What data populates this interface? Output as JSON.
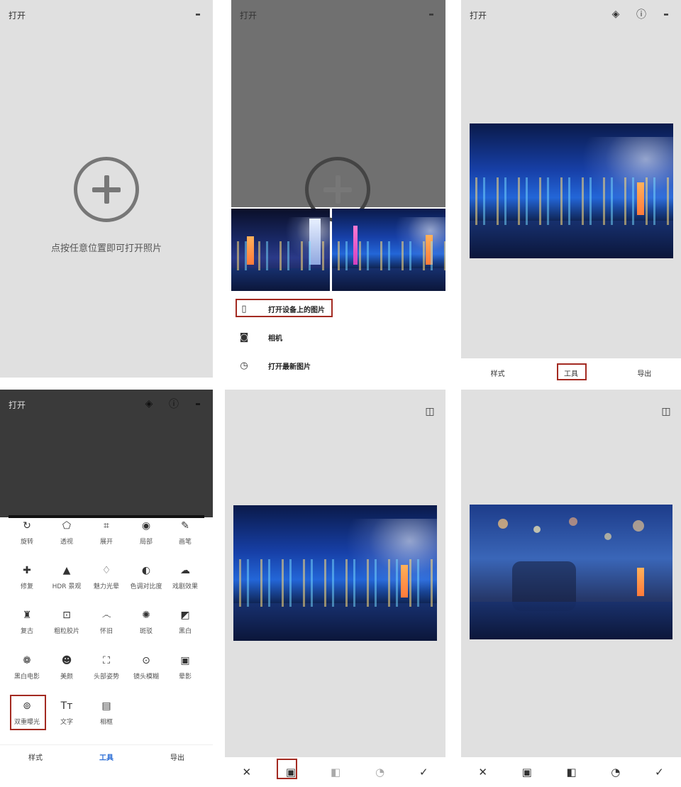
{
  "panel1": {
    "title": "打开",
    "hint": "点按任意位置即可打开照片"
  },
  "panel2": {
    "title": "打开",
    "sheet": [
      {
        "label": "打开设备上的图片",
        "icon": "phone-icon"
      },
      {
        "label": "相机",
        "icon": "camera-icon"
      },
      {
        "label": "打开最新图片",
        "icon": "clock-icon"
      }
    ]
  },
  "panel3": {
    "title": "打开",
    "tabs": [
      "样式",
      "工具",
      "导出"
    ]
  },
  "panel4": {
    "title": "打开",
    "tools": [
      {
        "label": "旋转",
        "icon": "rotate-icon"
      },
      {
        "label": "透视",
        "icon": "perspective-icon"
      },
      {
        "label": "展开",
        "icon": "expand-icon"
      },
      {
        "label": "局部",
        "icon": "selective-icon"
      },
      {
        "label": "画笔",
        "icon": "brush-icon"
      },
      {
        "label": "修复",
        "icon": "healing-icon"
      },
      {
        "label": "HDR 景观",
        "icon": "hdr-icon"
      },
      {
        "label": "魅力光晕",
        "icon": "glamour-glow-icon"
      },
      {
        "label": "色调对比度",
        "icon": "tonal-contrast-icon"
      },
      {
        "label": "戏剧效果",
        "icon": "drama-icon"
      },
      {
        "label": "复古",
        "icon": "vintage-icon"
      },
      {
        "label": "粗粒胶片",
        "icon": "grainy-film-icon"
      },
      {
        "label": "怀旧",
        "icon": "retrolux-icon"
      },
      {
        "label": "斑驳",
        "icon": "grunge-icon"
      },
      {
        "label": "黑白",
        "icon": "black-white-icon"
      },
      {
        "label": "黑白电影",
        "icon": "noir-icon"
      },
      {
        "label": "美颜",
        "icon": "face-icon"
      },
      {
        "label": "头部姿势",
        "icon": "head-pose-icon"
      },
      {
        "label": "镜头模糊",
        "icon": "lens-blur-icon"
      },
      {
        "label": "晕影",
        "icon": "vignette-icon"
      },
      {
        "label": "双重曝光",
        "icon": "double-exposure-icon"
      },
      {
        "label": "文字",
        "icon": "text-icon"
      },
      {
        "label": "相框",
        "icon": "frames-icon"
      }
    ],
    "tabs": [
      "样式",
      "工具",
      "导出"
    ],
    "active_tab_color": "#2f6fd6"
  },
  "colors": {
    "highlight": "#a32a21"
  }
}
